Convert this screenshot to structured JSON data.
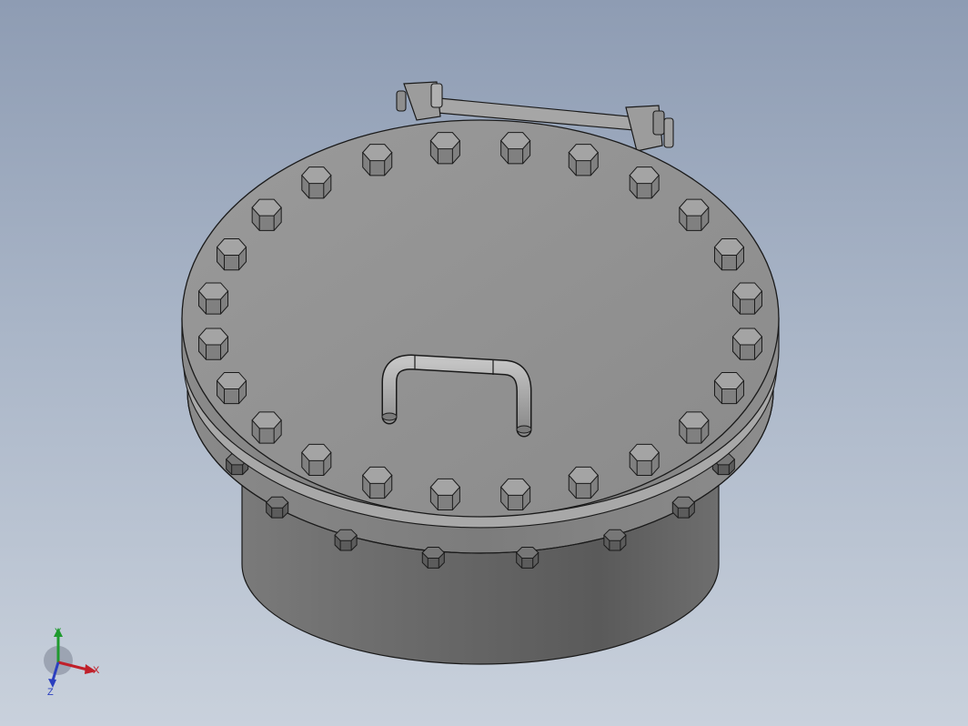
{
  "viewport": {
    "background_top": "#8e9cb3",
    "background_bottom": "#c9d1dc"
  },
  "model": {
    "part": "manhole-cover",
    "body_color": "#8c8c8c",
    "edge_color": "#1a1a1a",
    "cover_bolt_count": 24,
    "under_flange_nut_count": 8
  },
  "triad": {
    "x_label": "X",
    "y_label": "Y",
    "z_label": "Z",
    "x_color": "#c0202a",
    "y_color": "#1f9a2e",
    "z_color": "#2b3fbf"
  }
}
